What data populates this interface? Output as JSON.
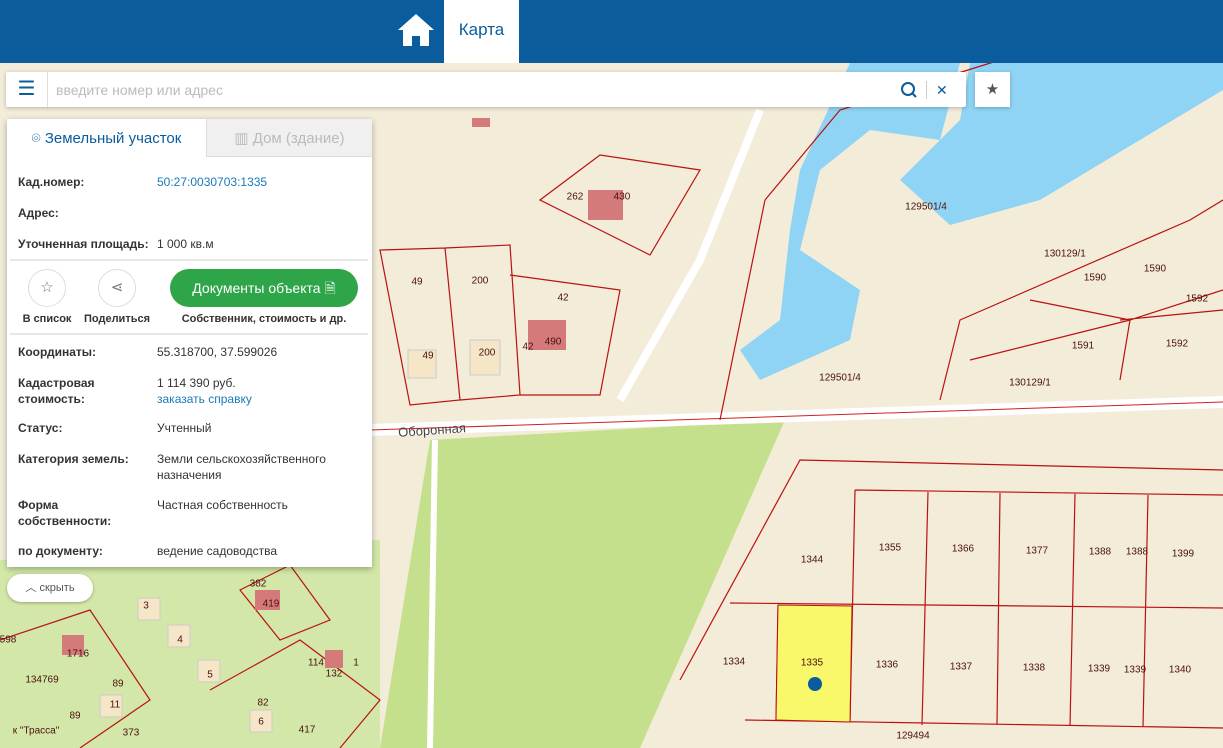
{
  "header": {
    "home_icon": "home-icon",
    "tab_label": "Карта"
  },
  "search": {
    "placeholder": "введите номер или адрес",
    "menu_icon": "☰",
    "search_icon": "search-icon",
    "clear_icon": "✕",
    "favorite_icon": "★"
  },
  "panel": {
    "tabs": [
      {
        "label": "Земельный участок",
        "icon": "map-pin-icon"
      },
      {
        "label": "Дом (здание)",
        "icon": "building-icon"
      }
    ],
    "kad_label": "Кад.номер:",
    "kad_value": "50:27:0030703:1335",
    "address_label": "Адрес:",
    "area_label": "Уточненная площадь:",
    "area_value": "1 000 кв.м",
    "actions": {
      "list_label": "В список",
      "share_label": "Поделиться",
      "docs_label": "Документы объекта",
      "docs_sub": "Собственник, стоимость и др."
    },
    "coords_label": "Координаты:",
    "coords_value": "55.318700, 37.599026",
    "cost_label": "Кадастровая стоимость:",
    "cost_value": "1 114 390 руб.",
    "cost_link": "заказать справку",
    "status_label": "Статус:",
    "status_value": "Учтенный",
    "category_label": "Категория земель:",
    "category_value": "Земли сельскохозяйственного назначения",
    "ownership_label": "Форма собственности:",
    "ownership_value": "Частная собственность",
    "doc_label": "по документу:",
    "doc_value": "ведение садоводства",
    "hide_label": "скрыть"
  },
  "map": {
    "labels": [
      "262",
      "430",
      "129501/4",
      "130129/1",
      "1590",
      "1590",
      "1592",
      "1591",
      "1592",
      "129501/4",
      "130129/1",
      "49",
      "200",
      "42",
      "49",
      "200",
      "42",
      "490",
      "Оборонная",
      "1344",
      "1355",
      "1366",
      "1377",
      "1388",
      "1388",
      "1399",
      "1334",
      "1335",
      "1336",
      "1337",
      "1338",
      "1339",
      "1339",
      "1340",
      "129494",
      "382",
      "419",
      "3",
      "4",
      "5",
      "114",
      "1",
      "132",
      "82",
      "6",
      "417",
      "89",
      "11",
      "89",
      "373",
      "134769",
      "1716",
      "598",
      "к \"Трасса\""
    ],
    "selected_color": "#f8f86a",
    "water_color": "#8fd4f5",
    "green_color": "#c5e08c"
  }
}
